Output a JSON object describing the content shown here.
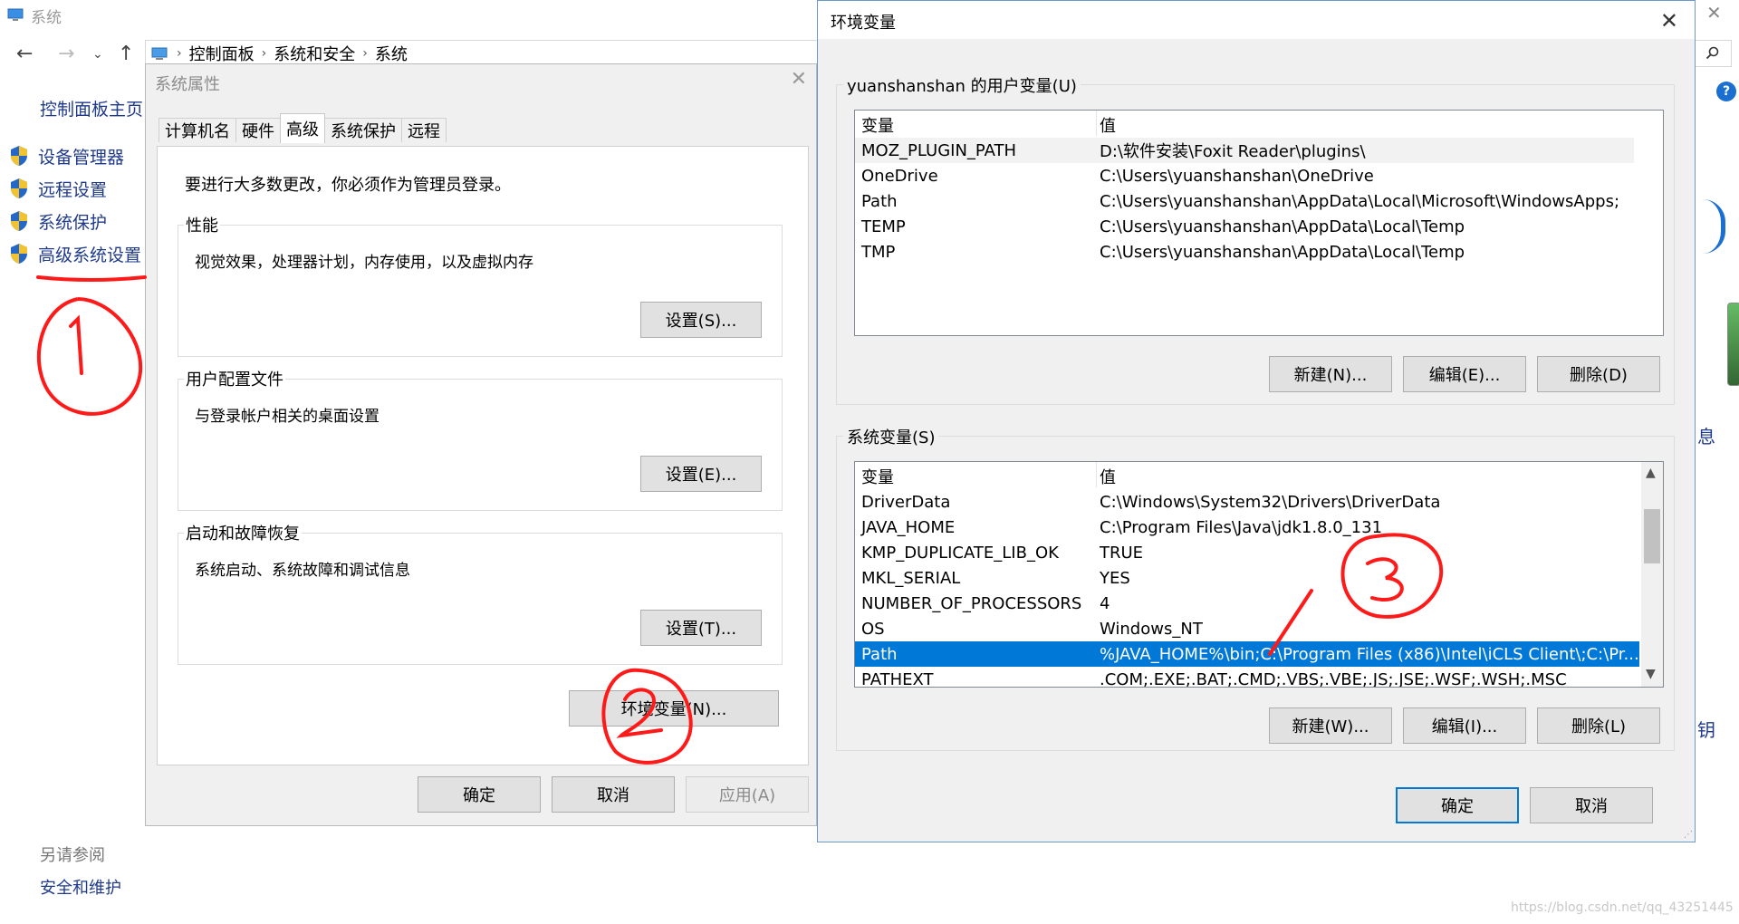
{
  "control_panel": {
    "title": "系统",
    "breadcrumb": [
      "控制面板",
      "系统和安全",
      "系统"
    ],
    "home_link": "控制面板主页",
    "links": [
      "设备管理器",
      "远程设置",
      "系统保护",
      "高级系统设置"
    ],
    "see_also": "另请参阅",
    "security_link": "安全和维护",
    "edge_chars": [
      "息",
      "钥"
    ]
  },
  "system_properties": {
    "title": "系统属性",
    "tabs": [
      "计算机名",
      "硬件",
      "高级",
      "系统保护",
      "远程"
    ],
    "active_tab": "高级",
    "notice": "要进行大多数更改，你必须作为管理员登录。",
    "groups": [
      {
        "label": "性能",
        "desc": "视觉效果，处理器计划，内存使用，以及虚拟内存",
        "button": "设置(S)..."
      },
      {
        "label": "用户配置文件",
        "desc": "与登录帐户相关的桌面设置",
        "button": "设置(E)..."
      },
      {
        "label": "启动和故障恢复",
        "desc": "系统启动、系统故障和调试信息",
        "button": "设置(T)..."
      }
    ],
    "env_button": "环境变量(N)...",
    "ok": "确定",
    "cancel": "取消",
    "apply": "应用(A)"
  },
  "env_vars": {
    "title": "环境变量",
    "user_section": "yuanshanshan 的用户变量(U)",
    "col_var": "变量",
    "col_val": "值",
    "user_vars": [
      {
        "name": "MOZ_PLUGIN_PATH",
        "value": "D:\\软件安装\\Foxit Reader\\plugins\\"
      },
      {
        "name": "OneDrive",
        "value": "C:\\Users\\yuanshanshan\\OneDrive"
      },
      {
        "name": "Path",
        "value": "C:\\Users\\yuanshanshan\\AppData\\Local\\Microsoft\\WindowsApps;"
      },
      {
        "name": "TEMP",
        "value": "C:\\Users\\yuanshanshan\\AppData\\Local\\Temp"
      },
      {
        "name": "TMP",
        "value": "C:\\Users\\yuanshanshan\\AppData\\Local\\Temp"
      }
    ],
    "user_buttons": [
      "新建(N)...",
      "编辑(E)...",
      "删除(D)"
    ],
    "system_section": "系统变量(S)",
    "system_vars": [
      {
        "name": "DriverData",
        "value": "C:\\Windows\\System32\\Drivers\\DriverData"
      },
      {
        "name": "JAVA_HOME",
        "value": "C:\\Program Files\\Java\\jdk1.8.0_131"
      },
      {
        "name": "KMP_DUPLICATE_LIB_OK",
        "value": "TRUE"
      },
      {
        "name": "MKL_SERIAL",
        "value": "YES"
      },
      {
        "name": "NUMBER_OF_PROCESSORS",
        "value": "4"
      },
      {
        "name": "OS",
        "value": "Windows_NT"
      },
      {
        "name": "Path",
        "value": "%JAVA_HOME%\\bin;C:\\Program Files (x86)\\Intel\\iCLS Client\\;C:\\Pr..."
      },
      {
        "name": "PATHEXT",
        "value": ".COM;.EXE;.BAT;.CMD;.VBS;.VBE;.JS;.JSE;.WSF;.WSH;.MSC"
      }
    ],
    "system_selected_index": 6,
    "system_buttons": [
      "新建(W)...",
      "编辑(I)...",
      "删除(L)"
    ],
    "ok": "确定",
    "cancel": "取消"
  },
  "watermark": "https://blog.csdn.net/qq_43251445",
  "colors": {
    "selection": "#0078d7",
    "annotation": "#ff1a1a",
    "link": "#1f3a8a"
  }
}
